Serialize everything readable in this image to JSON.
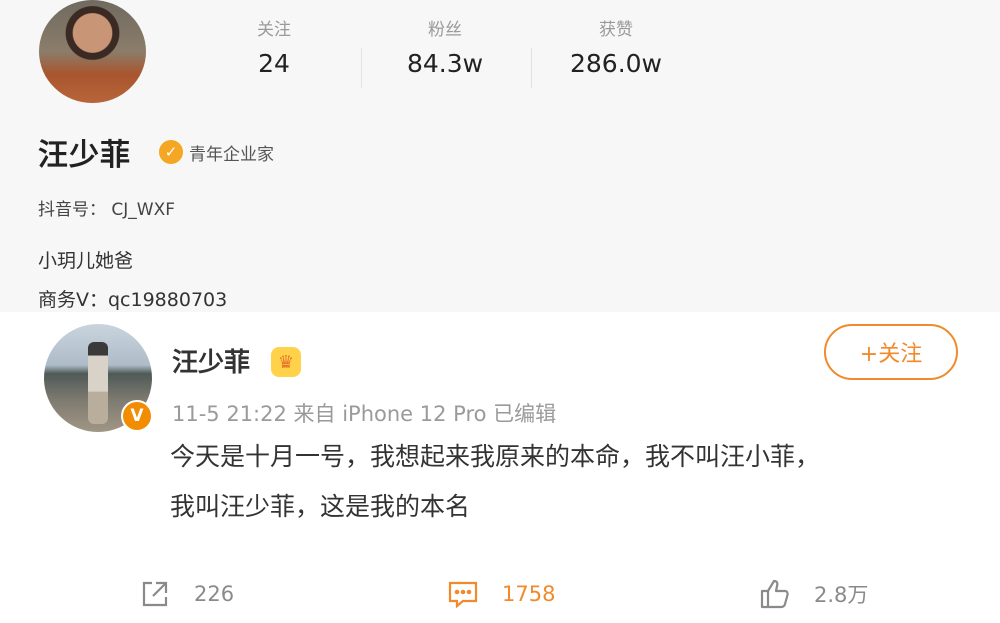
{
  "profile": {
    "stats": [
      {
        "label": "关注",
        "value": "24"
      },
      {
        "label": "粉丝",
        "value": "84.3w"
      },
      {
        "label": "获赞",
        "value": "286.0w"
      }
    ],
    "name": "汪少菲",
    "verification": "青年企业家",
    "douyin_id": "抖音号： CJ_WXF",
    "bio_line1": "小玥儿她爸",
    "bio_line2": "商务V：qc19880703"
  },
  "post": {
    "author": "汪少菲",
    "follow_label": "+关注",
    "meta": "11-5 21:22  来自 iPhone 12 Pro 已编辑",
    "text_line1": "今天是十月一号，我想起来我原来的本命，我不叫汪小菲，",
    "text_line2": "我叫汪少菲，这是我的本名",
    "actions": {
      "share_count": "226",
      "comment_count": "1758",
      "like_count": "2.8万"
    }
  },
  "colors": {
    "accent": "#f08a2a",
    "verify": "#f5a623",
    "profile_bg": "#f7f7f7"
  }
}
